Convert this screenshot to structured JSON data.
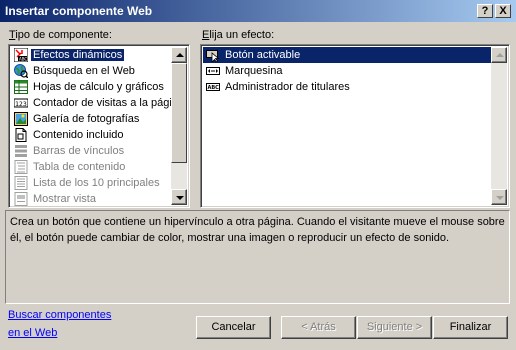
{
  "window": {
    "title": "Insertar componente Web",
    "help_label": "?",
    "close_label": "X"
  },
  "left_panel": {
    "label_accel": "T",
    "label_rest": "ipo de componente:",
    "items": [
      {
        "label": "Efectos dinámicos",
        "icon": "dynamic-effects-icon",
        "selected": true
      },
      {
        "label": "Búsqueda en el Web",
        "icon": "web-search-icon"
      },
      {
        "label": "Hojas de cálculo y gráficos",
        "icon": "spreadsheet-icon"
      },
      {
        "label": "Contador de visitas a la págin",
        "icon": "hit-counter-icon"
      },
      {
        "label": "Galería de fotografías",
        "icon": "photo-gallery-icon"
      },
      {
        "label": "Contenido incluido",
        "icon": "included-content-icon"
      },
      {
        "label": "Barras de vínculos",
        "icon": "link-bars-icon",
        "disabled": true
      },
      {
        "label": "Tabla de contenido",
        "icon": "table-of-contents-icon",
        "disabled": true
      },
      {
        "label": "Lista de los 10 principales",
        "icon": "top-ten-list-icon",
        "disabled": true
      },
      {
        "label": "Mostrar vista",
        "icon": "show-view-icon",
        "disabled": true
      }
    ]
  },
  "right_panel": {
    "label_accel": "E",
    "label_rest": "lija un efecto:",
    "items": [
      {
        "label": "Botón activable",
        "icon": "hover-button-icon",
        "selected": true
      },
      {
        "label": "Marquesina",
        "icon": "marquee-icon"
      },
      {
        "label": "Administrador de titulares",
        "icon": "banner-manager-icon"
      }
    ]
  },
  "description": "Crea un botón que contiene un hipervínculo a otra página. Cuando el visitante mueve el mouse sobre él, el botón puede cambiar de color, mostrar una imagen o reproducir un efecto de sonido.",
  "footer": {
    "link_line1": "Buscar componentes",
    "link_line2": "en el Web",
    "cancel": "Cancelar",
    "back": "< Atrás",
    "next": "Siguiente >",
    "finish": "Finalizar"
  },
  "colors": {
    "selection": "#0a246a",
    "face": "#d4d0c8",
    "link": "#0000ff"
  }
}
